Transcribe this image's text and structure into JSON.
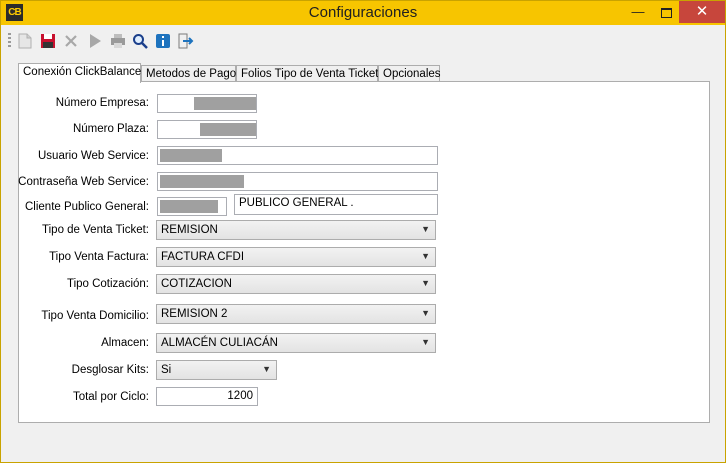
{
  "window": {
    "title": "Configuraciones",
    "app_icon_text": "CB"
  },
  "toolbar": {
    "buttons": [
      {
        "name": "new-document-icon"
      },
      {
        "name": "save-icon",
        "color": "#c8102e"
      },
      {
        "name": "delete-icon"
      },
      {
        "name": "run-icon"
      },
      {
        "name": "print-icon"
      },
      {
        "name": "search-icon"
      },
      {
        "name": "info-icon",
        "color": "#1e73be"
      },
      {
        "name": "exit-icon",
        "color": "#1e73be"
      }
    ]
  },
  "tabs": [
    {
      "label": "Conexión ClickBalance",
      "active": true
    },
    {
      "label": "Metodos de Pago",
      "active": false
    },
    {
      "label": "Folios Tipo de Venta Ticket",
      "active": false
    },
    {
      "label": "Opcionales",
      "active": false
    }
  ],
  "form": {
    "numero_empresa": {
      "label": "Número Empresa:",
      "value": "",
      "masked": true
    },
    "numero_plaza": {
      "label": "Número Plaza:",
      "value": "",
      "masked": true
    },
    "usuario_ws": {
      "label": "Usuario Web Service:",
      "value": "",
      "masked": true
    },
    "contrasena_ws": {
      "label": "Contraseña Web Service:",
      "value": "",
      "masked": true
    },
    "cliente_publico": {
      "label": "Cliente Publico General:",
      "code": "",
      "name": "PUBLICO GENERAL ."
    },
    "tipo_venta_ticket": {
      "label": "Tipo de Venta Ticket:",
      "value": "REMISION"
    },
    "tipo_venta_factura": {
      "label": "Tipo Venta Factura:",
      "value": "FACTURA CFDI"
    },
    "tipo_cotizacion": {
      "label": "Tipo Cotización:",
      "value": "COTIZACION"
    },
    "tipo_venta_domicilio": {
      "label": "Tipo Venta Domicilio:",
      "value": "REMISION 2"
    },
    "almacen": {
      "label": "Almacen:",
      "value": "ALMACÉN CULIACÁN"
    },
    "desglosar_kits": {
      "label": "Desglosar Kits:",
      "value": "Si"
    },
    "total_por_ciclo": {
      "label": "Total por Ciclo:",
      "value": "1200"
    }
  }
}
